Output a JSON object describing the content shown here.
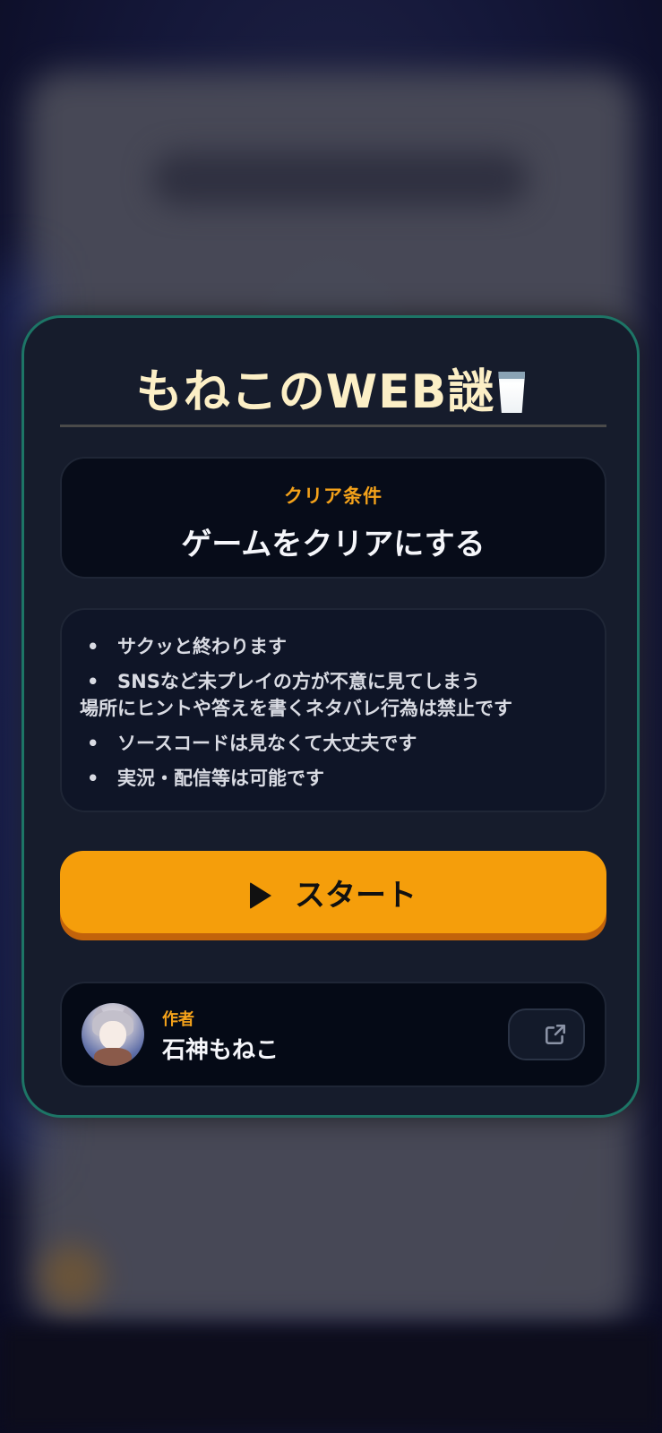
{
  "modal": {
    "title": "もねこのWEB謎",
    "title_icon": "milk-glass-icon",
    "clear_condition": {
      "label": "クリア条件",
      "value": "ゲームをクリアにする"
    },
    "rules": [
      {
        "line1": "サクッと終わります",
        "line2": ""
      },
      {
        "line1": "SNSなど未プレイの方が不意に見てしまう",
        "line2": "場所にヒントや答えを書くネタバレ行為は禁止です"
      },
      {
        "line1": "ソースコードは見なくて大丈夫です",
        "line2": ""
      },
      {
        "line1": "実況・配信等は可能です",
        "line2": ""
      }
    ],
    "bullet": "•",
    "start_button": {
      "label": "スタート",
      "icon": "play-icon"
    },
    "author": {
      "label": "作者",
      "name": "石神もねこ",
      "link_icon": "external-link-icon"
    }
  },
  "colors": {
    "accent": "#f59e0b",
    "border": "#1d7566",
    "title": "#fcefc6",
    "label": "#f4a21a"
  }
}
